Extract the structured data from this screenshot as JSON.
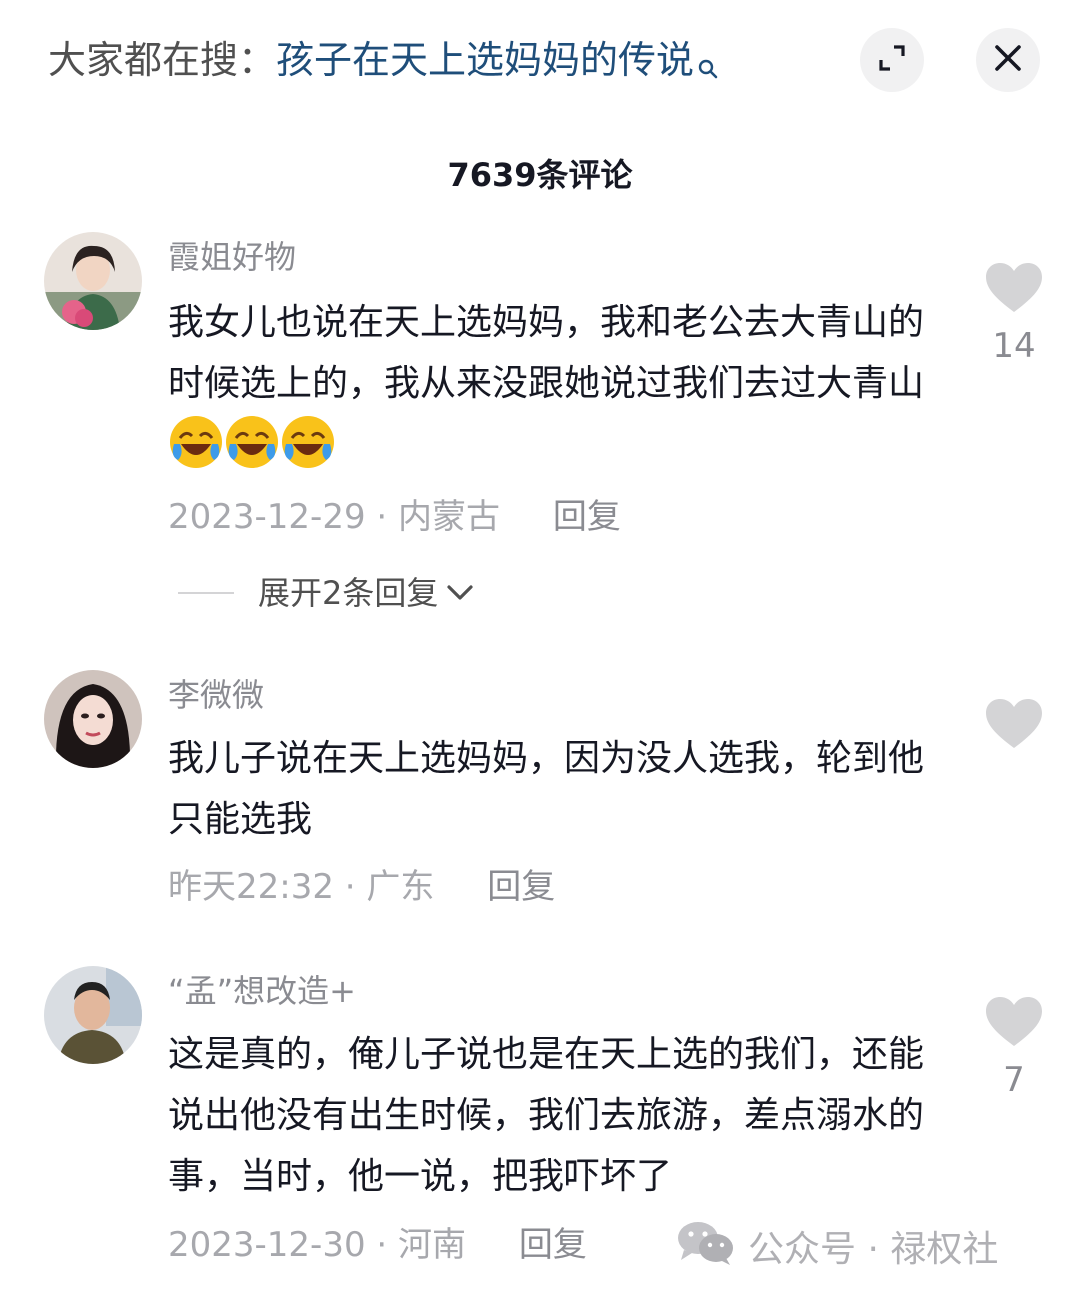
{
  "search": {
    "prefix": "大家都在搜：",
    "query": "孩子在天上选妈妈的传说"
  },
  "header": {
    "comment_count": "7639条评论"
  },
  "comments": [
    {
      "username": "霞姐好物",
      "text": "我女儿也说在天上选妈妈，我和老公去大青山的时候选上的，我从来没跟她说过我们去过大青山",
      "emoji_count": 3,
      "date": "2023-12-29",
      "location": "内蒙古",
      "reply": "回复",
      "likes": "14"
    },
    {
      "username": "李微微",
      "text": "我儿子说在天上选妈妈，因为没人选我，轮到他只能选我",
      "date": "昨天22:32",
      "location": "广东",
      "reply": "回复",
      "likes": ""
    },
    {
      "username": "“孟”想改造+",
      "text": "这是真的，俺儿子说也是在天上选的我们，还能说出他没有出生时候，我们去旅游，差点溺水的事，当时，他一说，把我吓坏了",
      "date": "2023-12-30",
      "location": "河南",
      "reply": "回复",
      "likes": "7"
    }
  ],
  "expand_replies": "展开2条回复",
  "watermark": "公众号 · 禄权社",
  "icons": {
    "search": "search-icon",
    "expand": "expand-icon",
    "close": "close-icon",
    "like": "heart-icon",
    "chevron": "chevron-down-icon",
    "emoji": "laugh-cry-emoji",
    "wechat": "wechat-icon"
  },
  "colors": {
    "query_link": "#1f4e7a",
    "secondary_text": "#8a8b91",
    "heart": "#d4d4d6"
  }
}
